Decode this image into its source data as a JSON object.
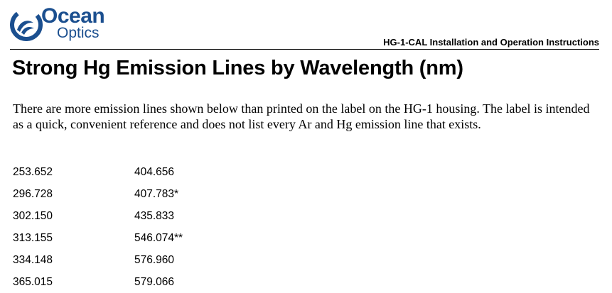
{
  "header": {
    "logo": {
      "word1": "Ocean",
      "word2": "Optics",
      "brand_color": "#1b4f8f",
      "icon": "ocean-optics-logo-icon"
    },
    "document_title": "HG-1-CAL Installation and Operation Instructions"
  },
  "section": {
    "heading": "Strong Hg Emission Lines by Wavelength (nm)",
    "intro": "There are more emission lines shown below than printed on the label on the HG-1 housing. The label is intended as a quick, convenient reference and does not list every Ar and Hg emission line that exists."
  },
  "wavelengths": {
    "rows": [
      [
        "253.652",
        "404.656"
      ],
      [
        "296.728",
        "407.783*"
      ],
      [
        "302.150",
        "435.833"
      ],
      [
        "313.155",
        "546.074**"
      ],
      [
        "334.148",
        "576.960"
      ],
      [
        "365.015",
        "579.066"
      ]
    ]
  }
}
